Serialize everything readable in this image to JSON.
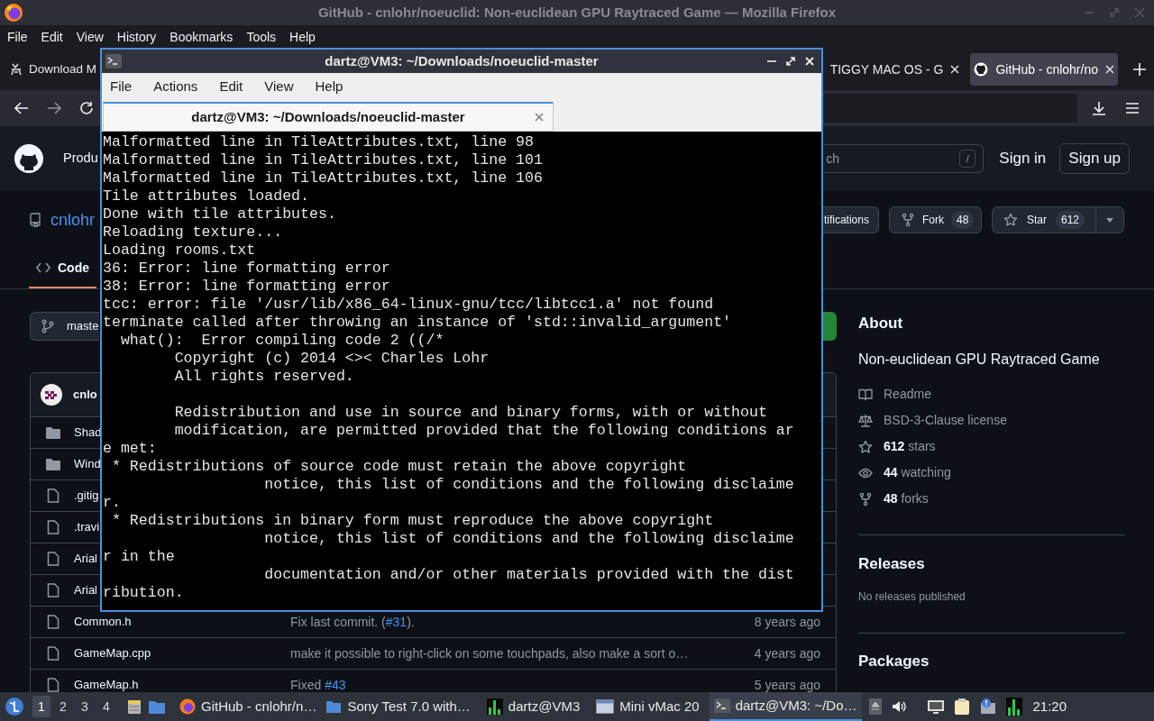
{
  "firefox": {
    "title": "GitHub - cnlohr/noeuclid: Non-euclidean GPU Raytraced Game — Mozilla Firefox",
    "menu": [
      "File",
      "Edit",
      "View",
      "History",
      "Bookmarks",
      "Tools",
      "Help"
    ],
    "tabs": [
      {
        "label": "Download M",
        "selected": false,
        "closable": false
      },
      {
        "label": "TIGGY MAC OS - G",
        "selected": false,
        "closable": true
      },
      {
        "label": "GitHub - cnlohr/no",
        "selected": true,
        "closable": true
      }
    ]
  },
  "github": {
    "header": {
      "nav_item": "Produ",
      "search_placeholder": "ch",
      "search_key": "/",
      "sign_in": "Sign in",
      "sign_up": "Sign up"
    },
    "repo": {
      "owner": "cnlohr",
      "notifications": "tifications",
      "fork": {
        "label": "Fork",
        "count": "48"
      },
      "star": {
        "label": "Star",
        "count": "612"
      },
      "tabs": [
        {
          "label": "Code",
          "selected": true
        }
      ]
    },
    "branch": "maste",
    "commit_author": "cnlo",
    "files": [
      {
        "kind": "folder",
        "name": "Shad"
      },
      {
        "kind": "folder",
        "name": "Wind"
      },
      {
        "kind": "file",
        "name": ".gitig"
      },
      {
        "kind": "file",
        "name": ".travi"
      },
      {
        "kind": "file",
        "name": "Arial"
      },
      {
        "kind": "file",
        "name": "Arial"
      },
      {
        "kind": "file",
        "name": "Common.h",
        "message": "Fix last commit. (",
        "issue": "#31",
        "message_after": ").",
        "time": "8 years ago"
      },
      {
        "kind": "file",
        "name": "GameMap.cpp",
        "message": "make it possible to right-click on some touchpads, also make a sort o…",
        "time": "4 years ago"
      },
      {
        "kind": "file",
        "name": "GameMap.h",
        "message": "Fixed ",
        "issue": "#43",
        "time": "5 years ago"
      }
    ],
    "about": {
      "heading": "About",
      "description": "Non-euclidean GPU Raytraced Game",
      "links": [
        {
          "kind": "book",
          "text": "Readme"
        },
        {
          "kind": "scale",
          "text": "BSD-3-Clause license"
        },
        {
          "kind": "star",
          "text": "**612** stars"
        },
        {
          "kind": "eye",
          "text": "**44** watching"
        },
        {
          "kind": "fork",
          "text": "**48** forks"
        }
      ]
    },
    "releases": {
      "heading": "Releases",
      "note": "No releases published"
    },
    "packages": {
      "heading": "Packages"
    }
  },
  "terminal": {
    "title": "dartz@VM3: ~/Downloads/noeuclid-master",
    "menu": [
      "File",
      "Actions",
      "Edit",
      "View",
      "Help"
    ],
    "tabs": [
      {
        "label": "dartz@VM3: ~/Downloads/noeuclid-master",
        "selected": true
      }
    ],
    "output": "Malformatted line in TileAttributes.txt, line 98\nMalformatted line in TileAttributes.txt, line 101\nMalformatted line in TileAttributes.txt, line 106\nTile attributes loaded.\nDone with tile attributes.\nReloading texture...\nLoading rooms.txt\n36: Error: line formatting error\n38: Error: line formatting error\ntcc: error: file '/usr/lib/x86_64-linux-gnu/tcc/libtcc1.a' not found\nterminate called after throwing an instance of 'std::invalid_argument'\n  what():  Error compiling code 2 ((/*\n        Copyright (c) 2014 <>< Charles Lohr\n        All rights reserved.\n\n        Redistribution and use in source and binary forms, with or without\n        modification, are permitted provided that the following conditions ar\ne met:\n * Redistributions of source code must retain the above copyright\n                  notice, this list of conditions and the following disclaime\nr.\n * Redistributions in binary form must reproduce the above copyright\n                  notice, this list of conditions and the following disclaime\nr in the\n                  documentation and/or other materials provided with the dist\nribution."
  },
  "taskbar": {
    "workspaces": [
      {
        "label": "1",
        "selected": true
      },
      {
        "label": "2",
        "selected": false
      },
      {
        "label": "3",
        "selected": false
      },
      {
        "label": "4",
        "selected": false
      }
    ],
    "tasks": [
      {
        "kind": "firefox",
        "label": "GitHub - cnlohr/n…",
        "selected": false
      },
      {
        "kind": "folder",
        "label": "Sony Test 7.0 with…",
        "selected": false
      },
      {
        "kind": "monitor",
        "label": "dartz@VM3",
        "selected": false
      },
      {
        "kind": "window",
        "label": "Mini vMac 20",
        "selected": false
      },
      {
        "kind": "terminal",
        "label": "dartz@VM3: ~/Do…",
        "selected": true
      }
    ],
    "clock": "21:20"
  }
}
